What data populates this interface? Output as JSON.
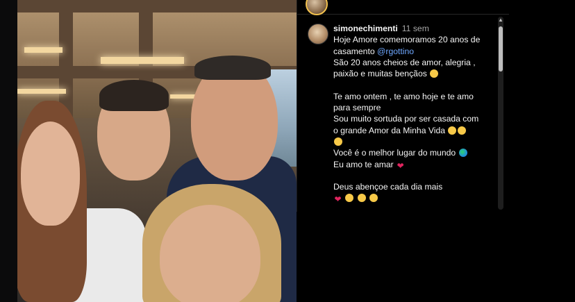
{
  "header": {
    "username": "simonechimenti",
    "time_ago": "11 sem"
  },
  "caption": {
    "line1": "Hoje Amore comemoramos 20 anos de",
    "line2_prefix": "casamento ",
    "mention": "@rgottino",
    "line3": "São 20 anos cheios de amor, alegria ,",
    "line4": "paixão e muitas bençãos",
    "line6": "Te amo ontem , te amo hoje e te amo",
    "line7": "para sempre",
    "line8": "Sou muito sortuda por ser casada com",
    "line9": "o grande Amor da Minha Vida",
    "line11": "Você é o melhor lugar do mundo",
    "line12": "Eu amo te amar",
    "line14": "Deus abençoe cada dia mais"
  },
  "icons": {
    "hands": "praying-hands-icon",
    "party": "party-face-icon",
    "earth": "earth-icon",
    "heart": "heart-icon"
  },
  "colors": {
    "mention": "#6fa8ff",
    "heart": "#e0245e",
    "time": "#a8a8a8",
    "text": "#f5f5f5"
  }
}
